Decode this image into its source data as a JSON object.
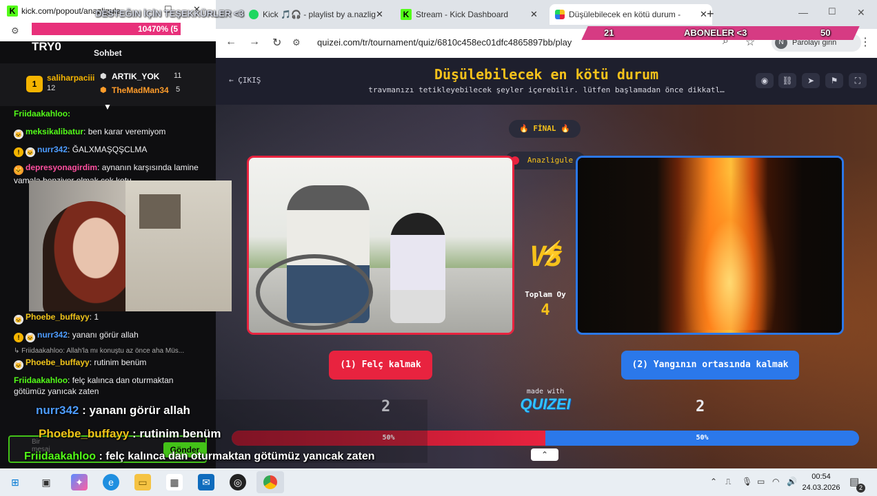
{
  "chat_window": {
    "url": "kick.com/popout/anazligule",
    "overlay_text": "DESTEĞIN İÇİN TEŞEKKÜRLER <3",
    "progress_label": "10470% (5",
    "goal_label": "TRY0",
    "chat_title": "Sohbet",
    "leaderboard": [
      {
        "rank": "1",
        "name": "saliharpaciii",
        "count": "12"
      },
      {
        "name": "ARTIK_YOK",
        "count": "11"
      },
      {
        "name": "TheMadMan34",
        "count": "5"
      }
    ],
    "messages": [
      {
        "user": "Friidaakahloo:",
        "text": "",
        "color": "green"
      },
      {
        "user": "meksikalibatur",
        "text": ": ben karar veremiyom",
        "color": "green"
      },
      {
        "user": "nurr342",
        "text": ": ĞALXMAŞQŞCLMA",
        "color": "blue"
      },
      {
        "user": "depresyonagirdim",
        "text": ": aynanın karşısında lamine vamala benziyor olmak cok kotu",
        "color": "pink"
      },
      {
        "user": "Phoebe_buffayy",
        "text": ": 1",
        "color": "yellow"
      },
      {
        "user": "nurr342",
        "text": ": yananı görür allah",
        "color": "blue"
      },
      {
        "user": "Friidaakahloo",
        "text": ": Allah'la mı konuştu az önce aha Müs...",
        "color": "grey"
      },
      {
        "user": "Phoebe_buffayy",
        "text": ": rutinim benüm",
        "color": "yellow"
      },
      {
        "user": "Friidaakahloo",
        "text": ": felç kalınca dan oturmaktan götümüz yanıcak zaten",
        "color": "green"
      }
    ],
    "input_placeholder": "Bir mesaj",
    "send_label": "Gönder"
  },
  "browser": {
    "tabs": [
      {
        "label": "Kick 🎵🎧 - playlist by a.nazlig"
      },
      {
        "label": "Stream - Kick Dashboard"
      },
      {
        "label": "Düşülebilecek en kötü durum -"
      }
    ],
    "url": "quizei.com/tr/tournament/quiz/6810c458ec01dfc4865897bb/play",
    "password_label": "Parolayı girin",
    "avatar_letter": "N"
  },
  "quiz": {
    "exit_label": "ÇIKIŞ",
    "title": "Düşülebilecek en kötü durum",
    "subtitle": "travmanızı tetikleyebilecek şeyler içerebilir. lütfen başlamadan önce dikkatl…",
    "round_label": "🔥 FİNAL 🔥",
    "streamer_label": "Anazligule",
    "vs_label": "VS",
    "total_votes_label": "Toplam Oy",
    "total_votes": "4",
    "options": [
      {
        "label": "(1) Felç kalmak",
        "votes": "2",
        "percent": "50%",
        "fraction": 0.5,
        "color": "#e8233f"
      },
      {
        "label": "(2) Yangının ortasında kalmak",
        "votes": "2",
        "percent": "50%",
        "fraction": 0.5,
        "color": "#2b78ea"
      }
    ],
    "made_with_label": "made with",
    "brand": "QUIZEI"
  },
  "stream_overlay": {
    "sub_left": "21",
    "sub_label": "ABONELER <3",
    "sub_right": "50",
    "chat_lines": [
      {
        "user": "nurr342",
        "text": " : yananı görür allah"
      },
      {
        "user": "Phoebe_buffayy",
        "text": " : rutinim benüm"
      },
      {
        "user": "Friidaakahloo",
        "text": " : felç kalınca dan oturmaktan götümüz yanıcak zaten"
      }
    ]
  },
  "taskbar": {
    "time": "00:54",
    "date": "24.03.2026",
    "notification_count": "2"
  }
}
